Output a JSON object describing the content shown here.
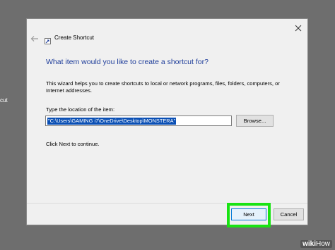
{
  "desktop": {
    "edge_text": "cut"
  },
  "dialog": {
    "title": "Create Shortcut",
    "heading": "What item would you like to create a shortcut for?",
    "description": "This wizard helps you to create shortcuts to local or network programs, files, folders, computers, or Internet addresses.",
    "field_label": "Type the location of the item:",
    "location_value": "\"C:\\Users\\GAMING i7\\OneDrive\\Desktop\\MONSTERA\"",
    "browse_label": "Browse...",
    "hint": "Click Next to continue.",
    "next_label": "Next",
    "cancel_label": "Cancel"
  },
  "watermark": {
    "brand": "wiki",
    "brand_suffix": "How"
  },
  "colors": {
    "highlight": "#19e313",
    "heading": "#1e3d9a",
    "selection": "#0a4fb4"
  },
  "icons": {
    "back": "back-arrow-icon",
    "wizard": "shortcut-wizard-icon",
    "close": "close-icon"
  }
}
